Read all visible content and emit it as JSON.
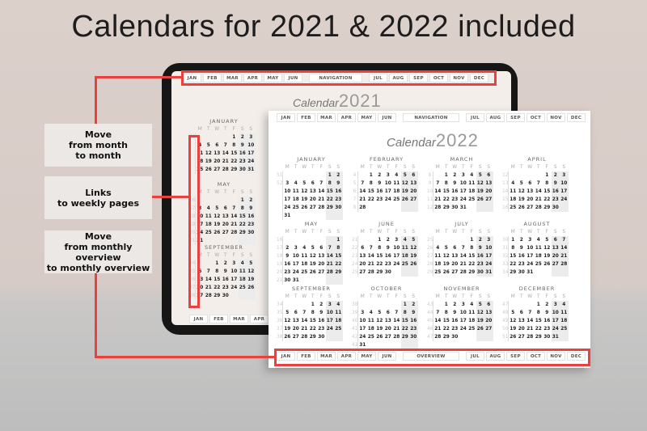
{
  "headline": "Calendars for 2021 & 2022 included",
  "colors": {
    "accent": "#e8413f",
    "weekend": "#ececec"
  },
  "weekdays": [
    "M",
    "T",
    "W",
    "T",
    "F",
    "S",
    "S"
  ],
  "labels": [
    "Move\nfrom month\nto month",
    "Links\nto weekly pages",
    "Move\nfrom monthly overview\nto monthly overview"
  ],
  "tablet": {
    "title_word": "Calendar",
    "year": "2021",
    "nav_top": [
      "JAN",
      "FEB",
      "MAR",
      "APR",
      "MAY",
      "JUN",
      "NAVIGATION",
      "JUL",
      "AUG",
      "SEP",
      "OCT",
      "NOV",
      "DEC"
    ],
    "nav_bottom": [
      "JAN",
      "FEB",
      "MAR",
      "APR"
    ],
    "months": [
      {
        "name": "JANUARY",
        "start": 4,
        "days": 31,
        "first_week": 53
      },
      {
        "name": "MAY",
        "start": 5,
        "days": 31,
        "first_week": 17
      },
      {
        "name": "SEPTEMBER",
        "start": 2,
        "days": 30,
        "first_week": 35
      }
    ]
  },
  "page": {
    "title_word": "Calendar",
    "year": "2022",
    "nav_top": [
      "JAN",
      "FEB",
      "MAR",
      "APR",
      "MAY",
      "JUN",
      "NAVIGATION",
      "JUL",
      "AUG",
      "SEP",
      "OCT",
      "NOV",
      "DEC"
    ],
    "nav_bottom": [
      "JAN",
      "FEB",
      "MAR",
      "APR",
      "MAY",
      "JUN",
      "OVERVIEW",
      "JUL",
      "AUG",
      "SEP",
      "OCT",
      "NOV",
      "DEC"
    ],
    "months": [
      {
        "name": "JANUARY",
        "start": 5,
        "days": 31,
        "first_week": 52
      },
      {
        "name": "FEBRUARY",
        "start": 1,
        "days": 28,
        "first_week": 5
      },
      {
        "name": "MARCH",
        "start": 1,
        "days": 31,
        "first_week": 9
      },
      {
        "name": "APRIL",
        "start": 4,
        "days": 30,
        "first_week": 13
      },
      {
        "name": "MAY",
        "start": 6,
        "days": 31,
        "first_week": 17
      },
      {
        "name": "JUNE",
        "start": 2,
        "days": 30,
        "first_week": 22
      },
      {
        "name": "JULY",
        "start": 4,
        "days": 31,
        "first_week": 26
      },
      {
        "name": "AUGUST",
        "start": 0,
        "days": 31,
        "first_week": 31
      },
      {
        "name": "SEPTEMBER",
        "start": 3,
        "days": 30,
        "first_week": 35
      },
      {
        "name": "OCTOBER",
        "start": 5,
        "days": 31,
        "first_week": 39
      },
      {
        "name": "NOVEMBER",
        "start": 1,
        "days": 30,
        "first_week": 44
      },
      {
        "name": "DECEMBER",
        "start": 3,
        "days": 31,
        "first_week": 48
      }
    ]
  }
}
